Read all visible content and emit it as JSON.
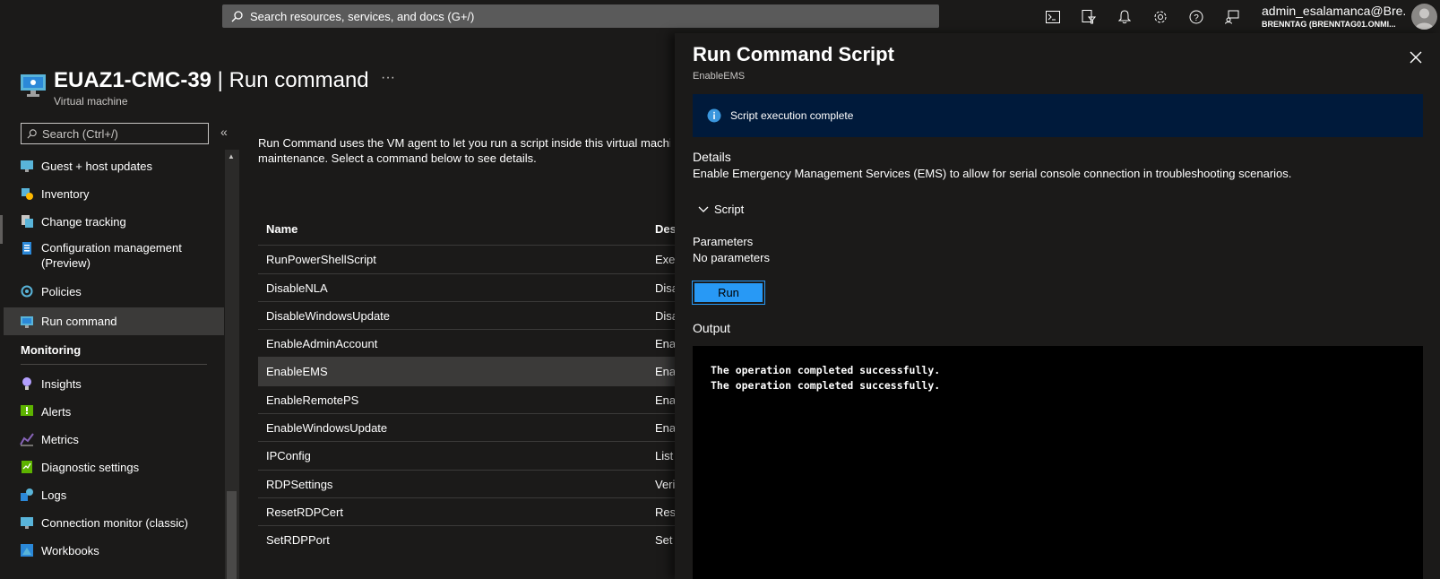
{
  "topbar": {
    "search_placeholder": "Search resources, services, and docs (G+/)",
    "icons": [
      "cloud-shell-icon",
      "directory-filter-icon",
      "notifications-icon",
      "settings-icon",
      "help-icon",
      "feedback-icon"
    ],
    "account_name": "admin_esalamanca@Bre...",
    "account_tenant": "BRENNTAG (BRENNTAG01.ONMI..."
  },
  "vm": {
    "name": "EUAZ1-CMC-39",
    "separator_title": " | Run command",
    "subtitle": "Virtual machine",
    "more": "···"
  },
  "sidebar": {
    "search_placeholder": "Search (Ctrl+/)",
    "collapse": "«",
    "items": [
      {
        "label": "Guest + host updates",
        "icon": "guest-host-updates-icon"
      },
      {
        "label": "Inventory",
        "icon": "inventory-icon"
      },
      {
        "label": "Change tracking",
        "icon": "change-tracking-icon"
      },
      {
        "label": "Configuration management\n(Preview)",
        "icon": "configuration-management-icon"
      },
      {
        "label": "Policies",
        "icon": "policies-icon"
      },
      {
        "label": "Run command",
        "icon": "run-command-icon",
        "active": true
      }
    ],
    "monitoring_header": "Monitoring",
    "monitoring_items": [
      {
        "label": "Insights",
        "icon": "insights-icon"
      },
      {
        "label": "Alerts",
        "icon": "alerts-icon"
      },
      {
        "label": "Metrics",
        "icon": "metrics-icon"
      },
      {
        "label": "Diagnostic settings",
        "icon": "diagnostic-settings-icon"
      },
      {
        "label": "Logs",
        "icon": "logs-icon"
      },
      {
        "label": "Connection monitor (classic)",
        "icon": "connection-monitor-icon"
      },
      {
        "label": "Workbooks",
        "icon": "workbooks-icon"
      }
    ]
  },
  "main": {
    "intro_line1": "Run Command uses the VM agent to let you run a script inside this virtual machin",
    "intro_line2": "maintenance. Select a command below to see details.",
    "table": {
      "headers": [
        "Name",
        "Des"
      ],
      "rows": [
        {
          "name": "RunPowerShellScript",
          "desc": "Exec"
        },
        {
          "name": "DisableNLA",
          "desc": "Disa"
        },
        {
          "name": "DisableWindowsUpdate",
          "desc": "Disa"
        },
        {
          "name": "EnableAdminAccount",
          "desc": "Enab"
        },
        {
          "name": "EnableEMS",
          "desc": "Enab",
          "selected": true
        },
        {
          "name": "EnableRemotePS",
          "desc": "Enab"
        },
        {
          "name": "EnableWindowsUpdate",
          "desc": "Enab"
        },
        {
          "name": "IPConfig",
          "desc": "List"
        },
        {
          "name": "RDPSettings",
          "desc": "Veri"
        },
        {
          "name": "ResetRDPCert",
          "desc": "Rest"
        },
        {
          "name": "SetRDPPort",
          "desc": "Set"
        }
      ]
    }
  },
  "panel": {
    "title": "Run Command Script",
    "subtitle": "EnableEMS",
    "info_message": "Script execution complete",
    "details_label": "Details",
    "details_text": "Enable Emergency Management Services (EMS) to allow for serial console connection in troubleshooting scenarios.",
    "script_label": "Script",
    "parameters_label": "Parameters",
    "parameters_text": "No parameters",
    "run_label": "Run",
    "output_label": "Output",
    "output_lines": [
      "The operation completed successfully.",
      "The operation completed successfully."
    ]
  },
  "colors": {
    "background": "#1b1a19",
    "info_bar": "#001a3b",
    "run_button": "#2899f5",
    "selected_row": "#3b3a39"
  }
}
